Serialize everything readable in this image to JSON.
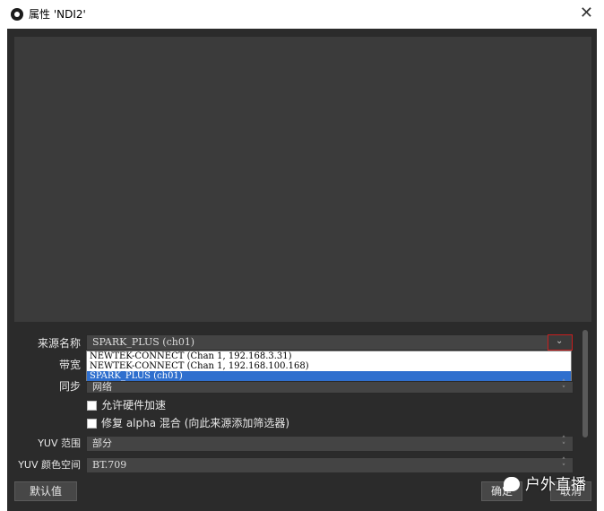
{
  "window": {
    "title": "属性 'NDI2'",
    "close_glyph": "✕"
  },
  "form": {
    "source_name_label": "来源名称",
    "source_name_value": "SPARK_PLUS (ch01)",
    "bandwidth_label": "带宽",
    "sync_label": "同步",
    "sync_value": "网络",
    "hw_accel_label": "允许硬件加速",
    "alpha_fix_label": "修复 alpha 混合 (向此来源添加筛选器)",
    "yuv_range_label": "YUV 范围",
    "yuv_range_value": "部分",
    "yuv_colorspace_label": "YUV 颜色空间",
    "yuv_colorspace_value": "BT.709"
  },
  "source_dropdown": {
    "options": [
      "NEWTEK-CONNECT (Chan 1, 192.168.3.31)",
      "NEWTEK-CONNECT (Chan 1, 192.168.100.168)",
      "SPARK_PLUS (ch01)"
    ],
    "selected_index": 2
  },
  "buttons": {
    "defaults": "默认值",
    "ok": "确定",
    "cancel": "取消"
  },
  "watermark": {
    "text": "户外直播"
  },
  "colors": {
    "panel": "#2b2b2b",
    "preview": "#3b3b3b",
    "selection": "#2f6fce",
    "highlight_border": "#c81e1e"
  }
}
